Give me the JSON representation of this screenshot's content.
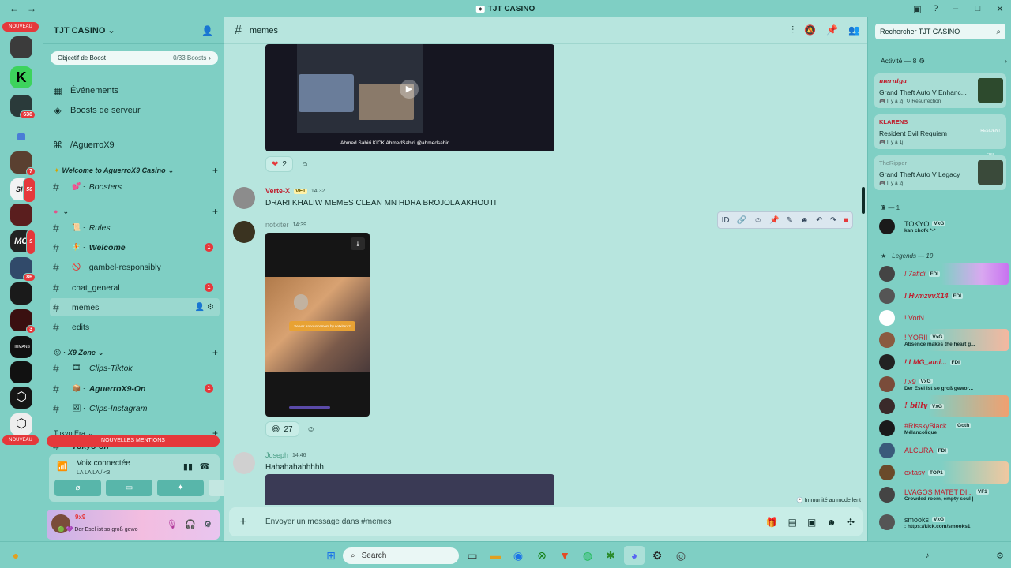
{
  "window": {
    "title": "TJT CASINO"
  },
  "server": {
    "name": "TJT CASINO",
    "boost_goal": "Objectif de Boost",
    "boost_count": "0/33 Boosts",
    "events": "Événements",
    "server_boosts": "Boosts de serveur",
    "vanity": "/AguerroX9"
  },
  "categories": {
    "welcome": "Welcome to AguerroX9 Casino",
    "x9zone": "X9 Zone",
    "tokyo": "Tokyo Era"
  },
  "channels": [
    {
      "label": "Boosters"
    },
    {
      "label": "Rules"
    },
    {
      "label": "Welcome"
    },
    {
      "label": "gambel-responsibly"
    },
    {
      "label": "chat_general"
    },
    {
      "label": "memes"
    },
    {
      "label": "edits"
    },
    {
      "label": "Clips-Tiktok"
    },
    {
      "label": "AguerroX9-On"
    },
    {
      "label": "Clips-Instagram"
    },
    {
      "label": "Tokyo-on"
    }
  ],
  "unread_badges": {
    "welcome": "1",
    "chat_general": "1",
    "aguerrox9_on": "1"
  },
  "rail_badges": [
    "638",
    "7",
    "50",
    "9",
    "86",
    "3"
  ],
  "rail_labels": {
    "top": "NOUVEAU",
    "bottom": "NOUVEAU",
    "new_mentions": "NOUVELLES MENTIONS"
  },
  "voice": {
    "status": "Voix connectée",
    "channel": "LA LA LA / <3"
  },
  "user": {
    "name": "9x9",
    "status": "Der Esel ist so groß gewo"
  },
  "channel_header": {
    "name": "memes"
  },
  "messages": [
    {
      "reaction_count": "2"
    },
    {
      "author": "Verte-X",
      "tag": "VF1",
      "time": "14:32",
      "text": "DRARI KHALIW MEMES CLEAN MN HDRA BROJOLA AKHOUTI"
    },
    {
      "author": "notxiter",
      "time": "14:39",
      "reaction_count": "27"
    },
    {
      "author": "Joseph",
      "time": "14:46",
      "text": "Hahahahahhhhh"
    }
  ],
  "video_captions": {
    "stream_overlay": "Ahmed Sabiri   KICK AhmedSabiri   @ahmedsabiri",
    "clip_overlay": "Server Announcement by notxiter42"
  },
  "slowmode": "Immunité au mode lent",
  "composer_placeholder": "Envoyer un message dans #memes",
  "search_placeholder": "Rechercher TJT CASINO",
  "activity": {
    "header": "Activité — 8",
    "cards": [
      {
        "user": "merniga",
        "game": "Grand Theft Auto V Enhanc...",
        "time": "Il y a 2j",
        "extra": "Résurrection"
      },
      {
        "user": "KLARENS",
        "game": "Resident Evil Requiem",
        "time": "Il y a 1j",
        "extra": ""
      },
      {
        "user": "TheRipper",
        "game": "Grand Theft Auto V Legacy",
        "time": "Il y a 2j",
        "extra": ""
      }
    ]
  },
  "member_groups": {
    "one": "— 1",
    "legends": "Legends — 19"
  },
  "members": [
    {
      "name": "TOKYO",
      "tag": "VxG",
      "status": "kan chofk *-*",
      "color": "#0f2c28"
    },
    {
      "name": "! 7afidi",
      "tag": "FDI",
      "status": "",
      "color": "#c01c2c"
    },
    {
      "name": "! HvmzvvX14",
      "tag": "FDI",
      "status": "",
      "color": "#c01c2c"
    },
    {
      "name": "! VorN",
      "tag": "",
      "status": "",
      "color": "#c01c2c"
    },
    {
      "name": "! YORII",
      "tag": "VxG",
      "status": "Absence makes the heart g...",
      "color": "#c01c2c"
    },
    {
      "name": "! LMG_ami...",
      "tag": "FDI",
      "status": "",
      "color": "#c01c2c"
    },
    {
      "name": "! x9",
      "tag": "VxG",
      "status": "Der Esel ist so groß gewor...",
      "color": "#c01c2c"
    },
    {
      "name": "! billy",
      "tag": "VxG",
      "status": "",
      "color": "#c01c2c"
    },
    {
      "name": "#RisskyBlack...",
      "tag": "Goth",
      "status": "Mélancolique",
      "color": "#c01c2c"
    },
    {
      "name": "ALCURA",
      "tag": "FDI",
      "status": "",
      "color": "#c01c2c"
    },
    {
      "name": "extasy",
      "tag": "TOP1",
      "status": "",
      "color": "#c01c2c"
    },
    {
      "name": "LVAGOS MATET DI...",
      "tag": "VF1",
      "status": "Crowded room, empty soul |",
      "color": "#c01c2c"
    },
    {
      "name": "smooks",
      "tag": "VxG",
      "status": ": https://kick.com/smooks1",
      "color": "#0f2c28"
    }
  ],
  "taskbar": {
    "search": "Search"
  },
  "colors": {
    "accent": "#7fcfc4",
    "main_bg": "#b7e5de",
    "danger": "#e5383b"
  }
}
